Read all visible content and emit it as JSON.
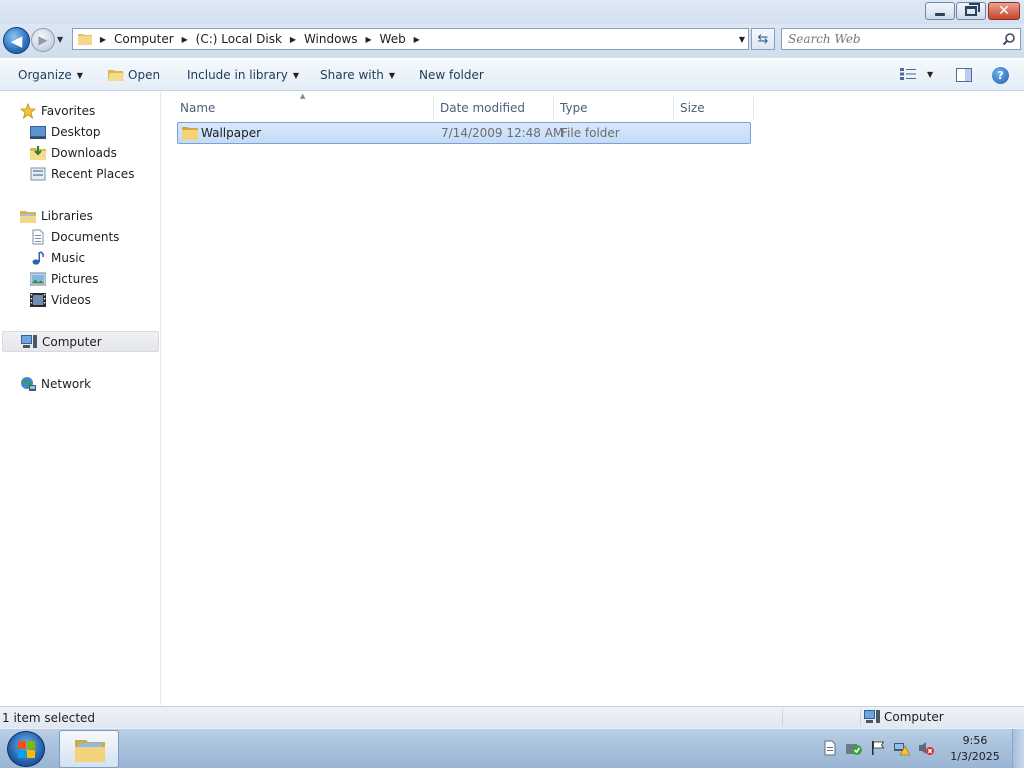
{
  "window": {
    "controls": {
      "minimize": "minimize",
      "maximize": "restore",
      "close": "close"
    }
  },
  "address_bar": {
    "crumbs": [
      "Computer",
      "(C:) Local Disk",
      "Windows",
      "Web"
    ]
  },
  "search": {
    "placeholder": "Search Web"
  },
  "toolbar": {
    "organize_label": "Organize",
    "open_label": "Open",
    "include_label": "Include in library",
    "share_label": "Share with",
    "new_folder_label": "New folder"
  },
  "nav_pane": {
    "favorites_label": "Favorites",
    "favorites_items": [
      "Desktop",
      "Downloads",
      "Recent Places"
    ],
    "libraries_label": "Libraries",
    "libraries_items": [
      "Documents",
      "Music",
      "Pictures",
      "Videos"
    ],
    "computer_label": "Computer",
    "network_label": "Network"
  },
  "file_list": {
    "columns": [
      "Name",
      "Date modified",
      "Type",
      "Size"
    ],
    "rows": [
      {
        "name": "Wallpaper",
        "date": "7/14/2009 12:48 AM",
        "type": "File folder",
        "size": ""
      }
    ]
  },
  "status_bar": {
    "selection_text": "1 item selected",
    "location_label": "Computer"
  },
  "taskbar": {
    "time": "9:56",
    "date": "1/3/2025"
  },
  "colors": {
    "selection_fill": "#cce2fa",
    "selection_border": "#7da2ce",
    "taskbar": "#a7c0dc",
    "close_button": "#c5442b"
  }
}
